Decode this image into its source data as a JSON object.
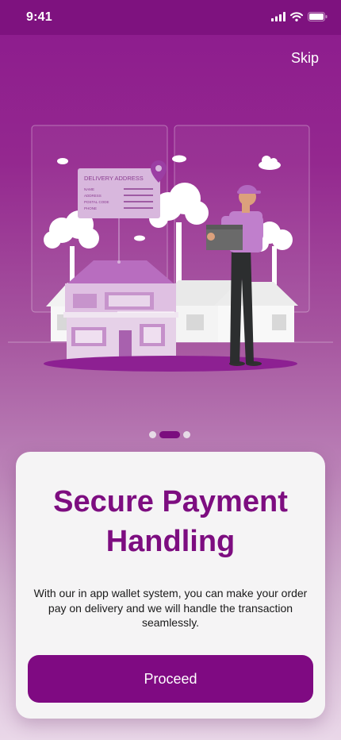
{
  "status_bar": {
    "time": "9:41",
    "icons": [
      "cellular-signal-icon",
      "wifi-icon",
      "battery-icon"
    ]
  },
  "header": {
    "skip_label": "Skip"
  },
  "illustration": {
    "card_title": "DELIVERY ADDRESS",
    "card_fields": [
      "NAME",
      "ADDRESS",
      "POSTAL CODE",
      "PHONE"
    ]
  },
  "pager": {
    "page_count": 3,
    "active_index": 1
  },
  "onboarding": {
    "title": "Secure Payment Handling",
    "description": "With our in app wallet system, you can make your order pay on delivery and we will handle the transaction seamlessly.",
    "proceed_label": "Proceed"
  },
  "colors": {
    "brand": "#7f0a82",
    "status_bar": "#7e127f",
    "card_background": "#f5f4f5",
    "title_text": "#7d0d80"
  }
}
